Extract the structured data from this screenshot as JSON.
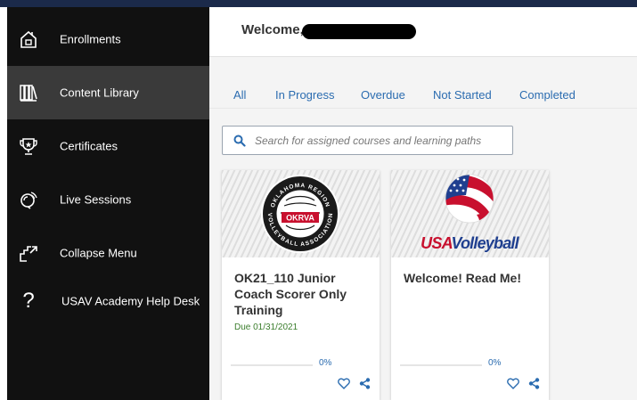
{
  "sidebar": {
    "items": [
      {
        "label": "Enrollments",
        "icon": "enrollments-house-icon"
      },
      {
        "label": "Content Library",
        "icon": "library-books-icon"
      },
      {
        "label": "Certificates",
        "icon": "trophy-certificate-icon"
      },
      {
        "label": "Live Sessions",
        "icon": "live-sessions-icon"
      },
      {
        "label": "Collapse Menu",
        "icon": "collapse-menu-icon"
      },
      {
        "label": "USAV Academy Help Desk",
        "icon": "help-question-icon"
      }
    ],
    "help_glyph": "?"
  },
  "header": {
    "welcome": "Welcome,"
  },
  "tabs": [
    "All",
    "In Progress",
    "Overdue",
    "Not Started",
    "Completed"
  ],
  "search": {
    "placeholder": "Search for assigned courses and learning paths"
  },
  "cards": [
    {
      "title": "OK21_110 Junior Coach Scorer Only Training",
      "due": "Due 01/31/2021",
      "progress_label": "0%",
      "progress": 0,
      "logo": {
        "top_text": "OKLAHOMA REGION",
        "bottom_text": "VOLLEYBALL ASSOCIATION",
        "center_text": "OKRVA"
      }
    },
    {
      "title": "Welcome! Read Me!",
      "due": "",
      "progress_label": "0%",
      "progress": 0,
      "logo": {
        "wordmark_a": "USA",
        "wordmark_b": "Volleyball"
      }
    }
  ],
  "colors": {
    "sidebar_bg": "#111111",
    "sidebar_active": "#3a3a3a",
    "accent_blue": "#2b6cb0",
    "due_green": "#3a7d2c",
    "usa_red": "#c8102e",
    "usa_blue": "#1f3f8f"
  }
}
